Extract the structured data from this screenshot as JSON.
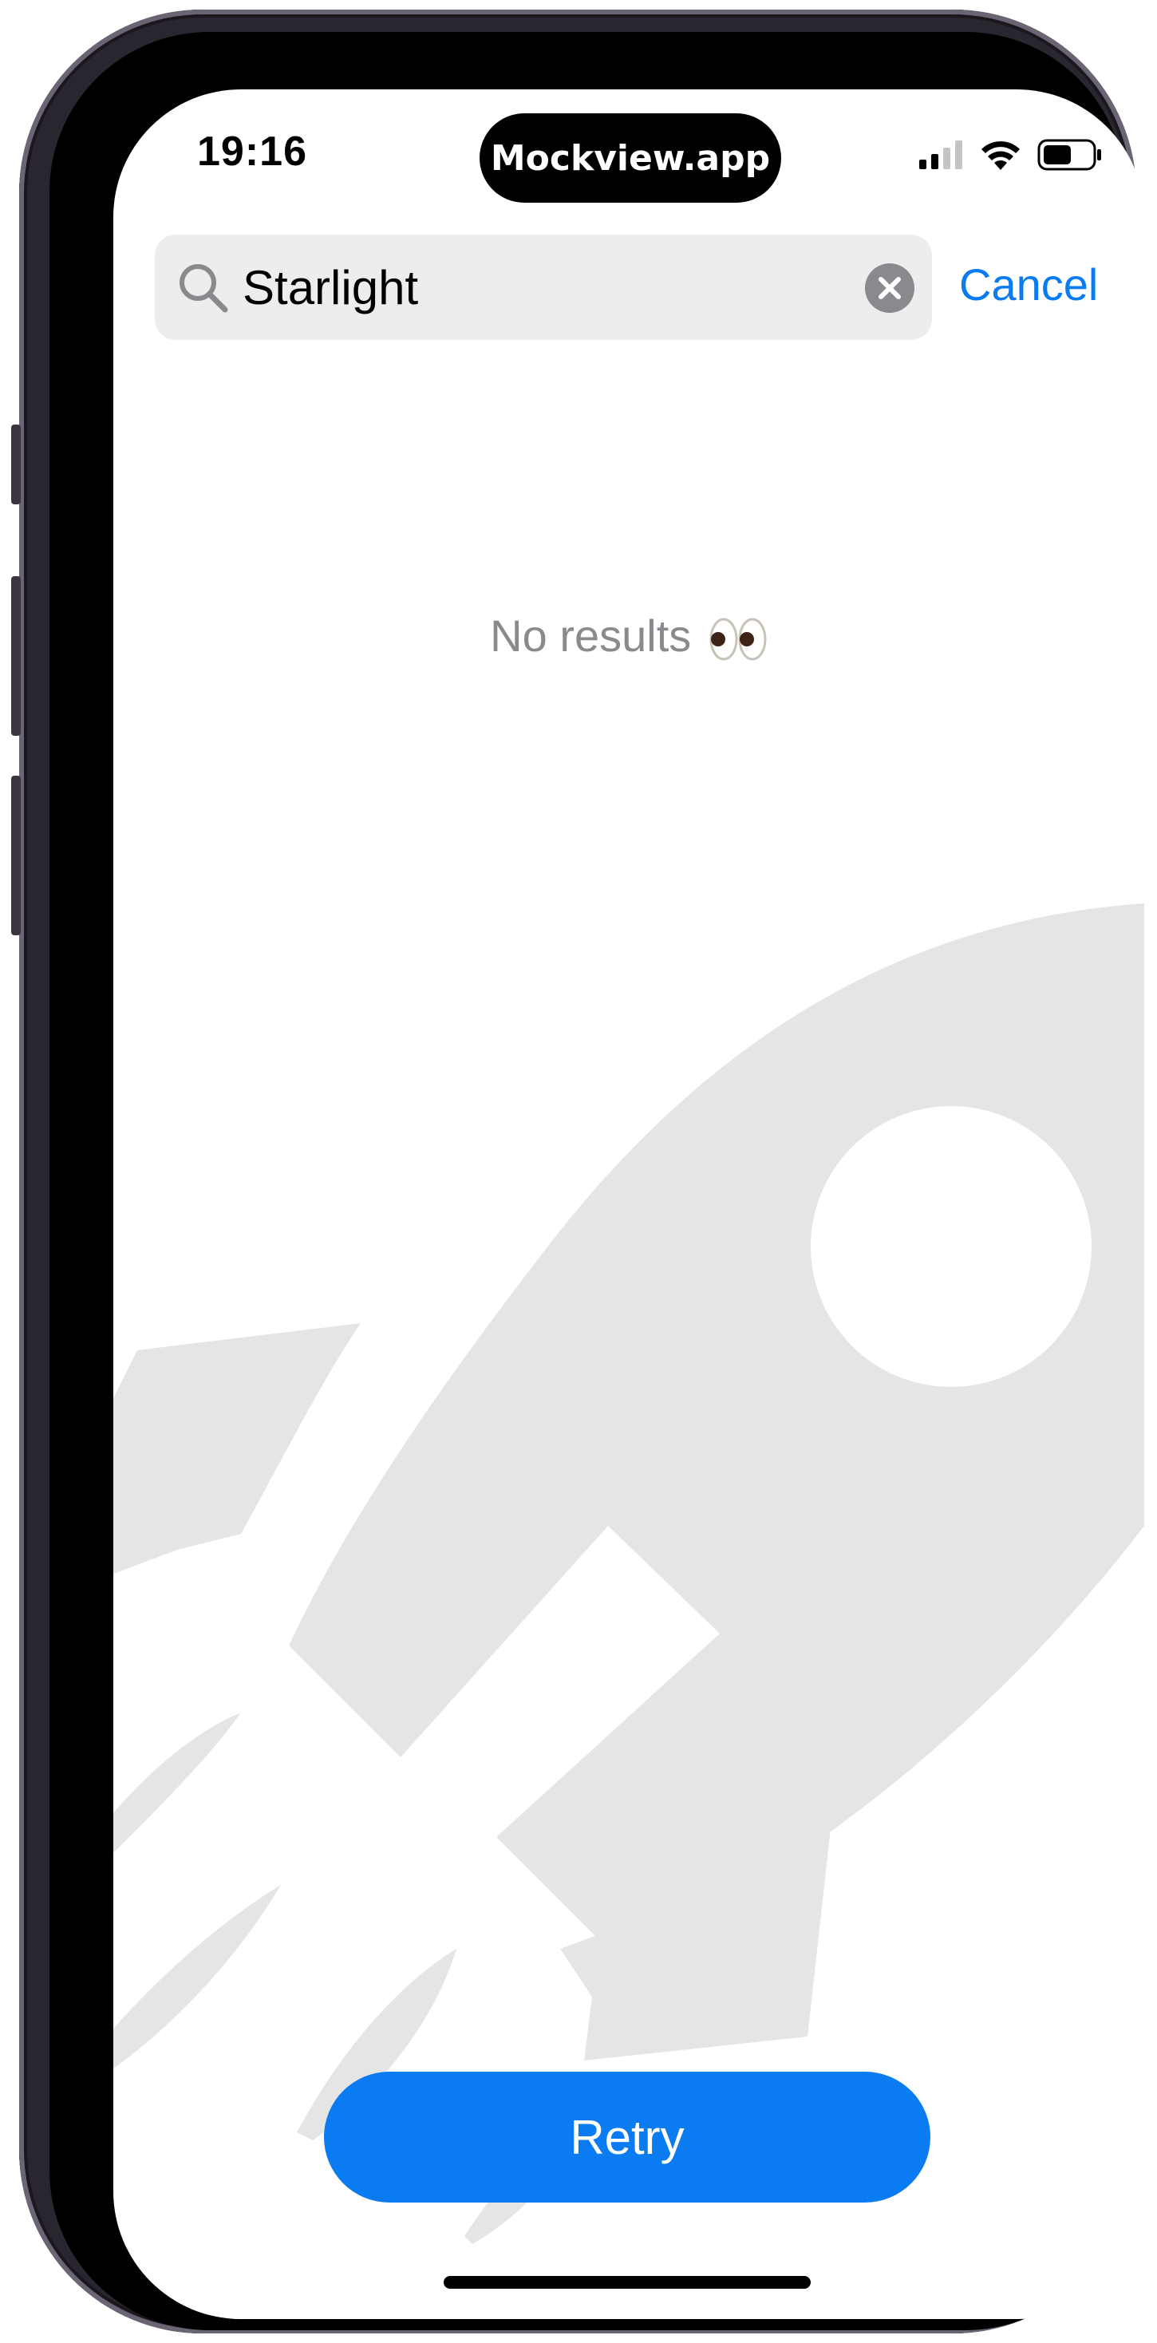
{
  "status_bar": {
    "time": "19:16",
    "island_label": "Mockview.app"
  },
  "search": {
    "query": "Starlight",
    "cancel_label": "Cancel"
  },
  "empty_state": {
    "message": "No results"
  },
  "actions": {
    "retry_label": "Retry"
  },
  "icons": {
    "search": "search-icon",
    "clear": "clear-icon",
    "background": "rocket-icon",
    "signal": "signal-icon",
    "wifi": "wifi-icon",
    "battery": "battery-icon",
    "eyes": "eyes-emoji"
  },
  "colors": {
    "accent": "#0a7bf0",
    "search_bg": "#ededee",
    "secondary_text": "#8a8a8e",
    "illustration": "#e5e5e5"
  }
}
